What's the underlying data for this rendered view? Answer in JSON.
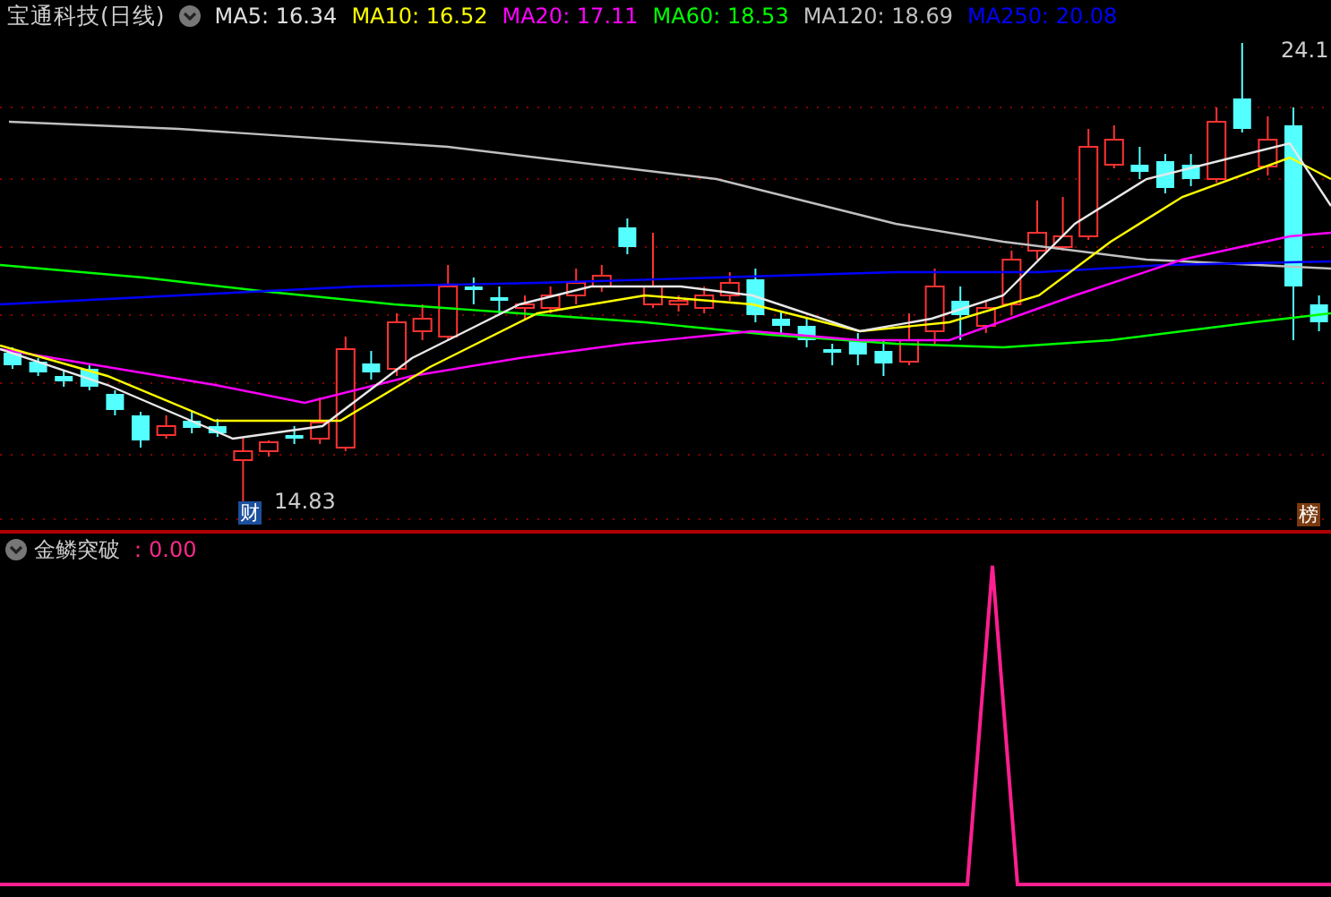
{
  "title": "宝通科技(日线)",
  "indicators": [
    {
      "label": "MA5: 16.34",
      "color": "#e0e0e0"
    },
    {
      "label": "MA10: 16.52",
      "color": "#ffff00"
    },
    {
      "label": "MA20: 17.11",
      "color": "#ff00ff"
    },
    {
      "label": "MA60: 18.53",
      "color": "#00ff00"
    },
    {
      "label": "MA120: 18.69",
      "color": "#c0c0c0"
    },
    {
      "label": "MA250: 20.08",
      "color": "#0000ff"
    }
  ],
  "price_chart": {
    "high_label": "24.1",
    "low_label": "14.83",
    "markers": [
      {
        "text": "财",
        "color": "#1c4f9c"
      },
      {
        "text": "榜",
        "color": "#7a3a10"
      }
    ]
  },
  "sub_chart": {
    "title": "金鳞突破",
    "value": "：0.00"
  }
}
